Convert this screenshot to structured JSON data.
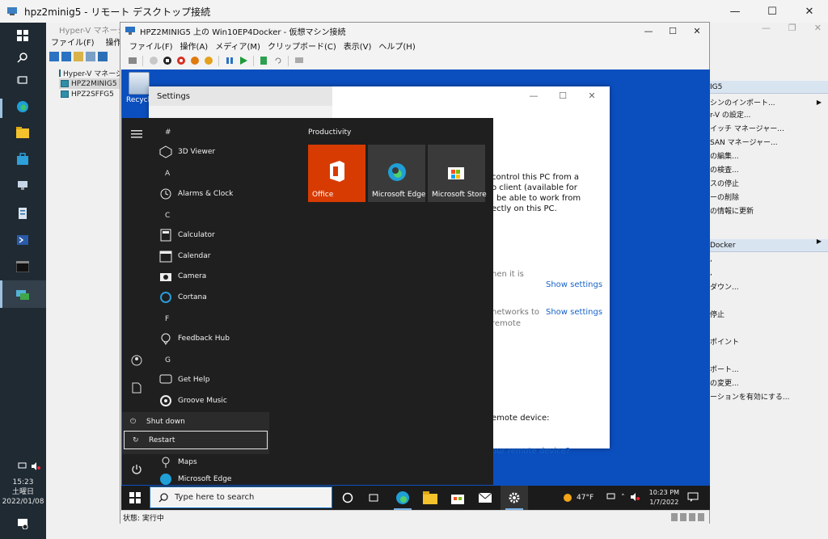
{
  "rdp": {
    "title": "hpz2minig5 - リモート デスクトップ接続",
    "controls": [
      "—",
      "☐",
      "✕"
    ]
  },
  "host_taskbar": {
    "time": "15:23",
    "day": "土曜日",
    "date": "2022/01/08"
  },
  "hyperv_manager": {
    "title": "Hyper-V マネージャー",
    "menu": [
      "ファイル(F)",
      "操作(A)"
    ],
    "tree": [
      "Hyper-V マネージャー",
      "HPZ2MINIG5",
      "HPZ2SFFG5"
    ],
    "actions_header_1": "IG5",
    "actions_group_1": [
      "シンのインポート...",
      "r-V の設定...",
      "イッチ マネージャー...",
      "SAN マネージャー...",
      "の編集...",
      "の検査...",
      "スの停止",
      "ーの削除",
      "の情報に更新"
    ],
    "actions_header_2": "Docker",
    "actions_group_2": [
      ",",
      ",",
      "ダウン...",
      "",
      "停止",
      "",
      "ポイント",
      "",
      "ポート...",
      "の変更...",
      "ーションを有効にする..."
    ]
  },
  "vm_window": {
    "title": "HPZ2MINIG5 上の Win10EP4Docker - 仮想マシン接続",
    "menu": [
      "ファイル(F)",
      "操作(A)",
      "メディア(M)",
      "クリップボード(C)",
      "表示(V)",
      "ヘルプ(H)"
    ],
    "status": "状態: 実行中"
  },
  "guest": {
    "recycle_bin": "Recycle",
    "settings": {
      "title": "Settings",
      "body_lines": [
        "control this PC from a",
        "o client (available for",
        "l be able to work from",
        "ectly on this PC."
      ],
      "gray_1": "hen it is",
      "gray_2a": "networks to",
      "gray_2b": "remote",
      "link_1": "Show settings",
      "link_2": "Show settings",
      "remote_device": "emote device:",
      "link_3": "our remote device?"
    },
    "start_menu": {
      "letters": [
        "#",
        "A",
        "C",
        "F",
        "G"
      ],
      "apps": [
        "3D Viewer",
        "Alarms & Clock",
        "Calculator",
        "Calendar",
        "Camera",
        "Cortana",
        "Feedback Hub",
        "Get Help",
        "Groove Music",
        "Maps",
        "Microsoft Edge"
      ],
      "tiles_header": "Productivity",
      "tiles": [
        "Office",
        "Microsoft Edge",
        "Microsoft Store"
      ],
      "power_menu": [
        "Shut down",
        "Restart"
      ]
    },
    "taskbar": {
      "search_placeholder": "Type here to search",
      "weather": "47°F",
      "time": "10:23 PM",
      "date": "1/7/2022"
    }
  },
  "colors": {
    "desktop_blue": "#0b4fbf",
    "office_tile": "#d83b01",
    "tile_gray": "#3a3a3a",
    "link_blue": "#1763c9"
  }
}
